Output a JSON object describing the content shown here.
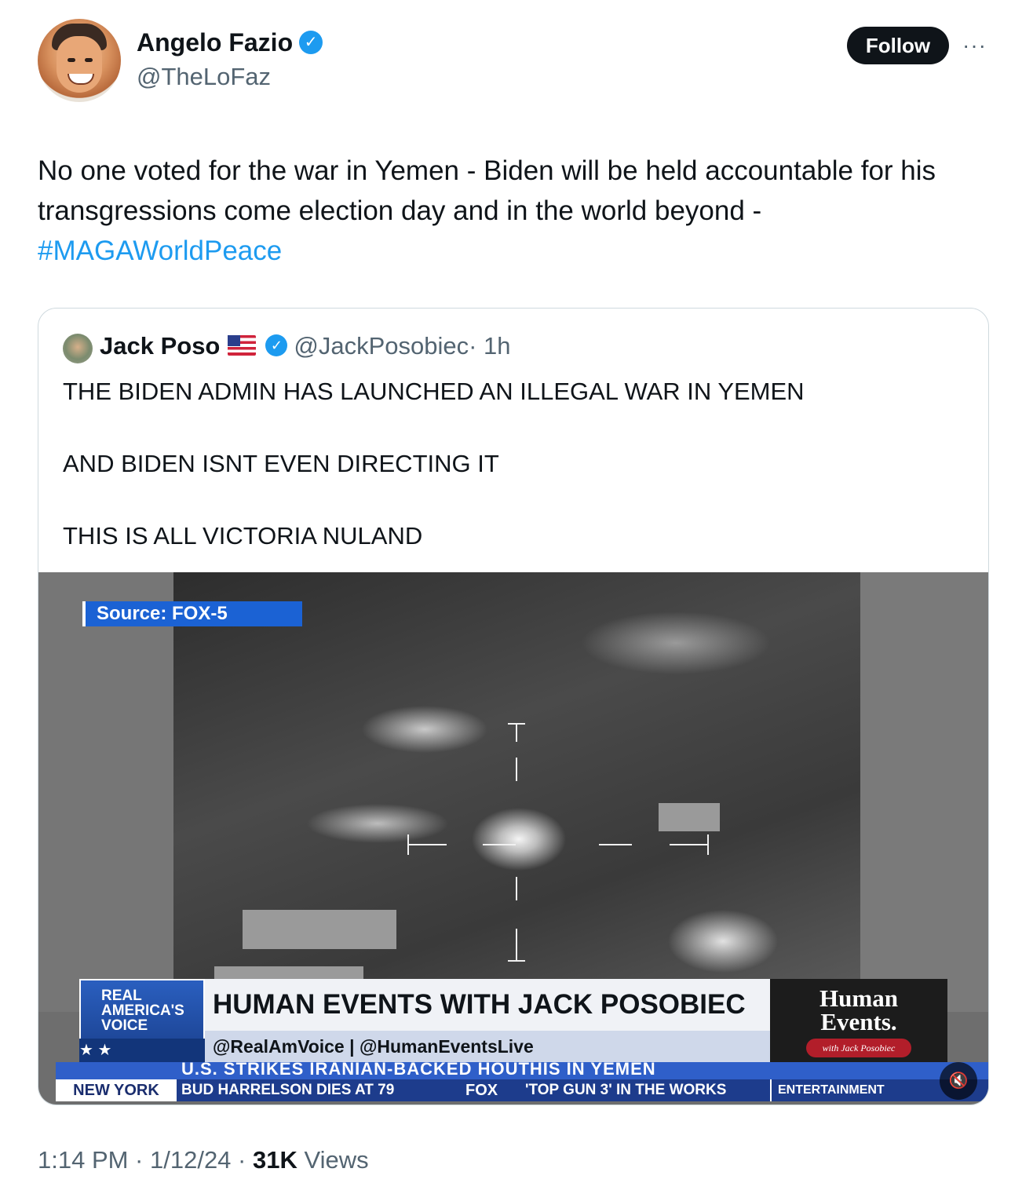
{
  "author": {
    "name": "Angelo Fazio",
    "handle": "@TheLoFaz",
    "verified_icon": "verified-badge-icon"
  },
  "actions": {
    "follow_label": "Follow",
    "more_label": "···"
  },
  "tweet": {
    "text": "No one voted for the war in Yemen - Biden will be held accountable for his transgressions come election day and in the world beyond - ",
    "hashtag": "#MAGAWorldPeace"
  },
  "quote": {
    "name": "Jack Poso",
    "flag": "🇺🇸",
    "handle": "@JackPosobiec",
    "time": "· 1h",
    "lines": [
      "THE BIDEN ADMIN HAS LAUNCHED AN ILLEGAL WAR IN YEMEN",
      "AND BIDEN ISNT EVEN DIRECTING IT",
      "THIS IS ALL VICTORIA NULAND"
    ]
  },
  "video": {
    "source_label": "Source: FOX-5",
    "rav_logo": "REAL AMERICA'S VOICE",
    "rav_stars": "★                    ★",
    "show_title": "HUMAN EVENTS WITH JACK POSOBIEC",
    "show_sub": "@RealAmVoice | @HumanEventsLive",
    "he_logo_line1": "Human",
    "he_logo_line2": "Events.",
    "he_sub": "with Jack Posobiec",
    "ticker_headline": "U.S. STRIKES IRANIAN-BACKED HOUTHIS IN YEMEN",
    "ticker_city": "NEW YORK",
    "ticker_item1": "BUD HARRELSON DIES AT 79",
    "ticker_fox": "FOX",
    "ticker_item2": "'TOP GUN 3' IN THE WORKS",
    "ticker_tag": "ENTERTAINMENT",
    "mute_icon": "muted-speaker-icon"
  },
  "meta": {
    "time": "1:14 PM · 1/12/24 · ",
    "views_count": "31K",
    "views_label": " Views"
  },
  "colors": {
    "accent": "#1d9bf0",
    "text": "#0f1419",
    "muted": "#536471",
    "border": "#cfd9de"
  }
}
